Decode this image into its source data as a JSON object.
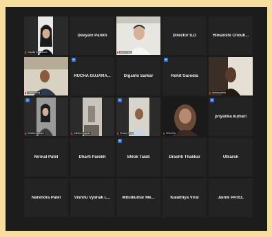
{
  "participants": [
    {
      "name": "Inayatla Chakrabarti",
      "kind": "video"
    },
    {
      "name": "Devyani Parikh",
      "kind": "name"
    },
    {
      "name": "Darsh Patel",
      "kind": "video",
      "active": true
    },
    {
      "name": "Director ILG",
      "kind": "name"
    },
    {
      "name": "Himanshi Chouh...",
      "kind": "name"
    },
    {
      "name": "Tushar Tyagi",
      "kind": "video"
    },
    {
      "name": "RUCHA GUJARA...",
      "kind": "name",
      "badge": "H"
    },
    {
      "name": "Diganto Sarkar",
      "kind": "name"
    },
    {
      "name": "Rohit Garodia",
      "kind": "name",
      "badge": "H"
    },
    {
      "name": "aishwaryatalla",
      "kind": "video"
    },
    {
      "name": "Drishika Kulkarni",
      "kind": "video",
      "badge": "H"
    },
    {
      "name": "prithikurv...ajpura",
      "kind": "video"
    },
    {
      "name": "Himang Tyagi",
      "kind": "video",
      "badge": "H"
    },
    {
      "name": "Hritha Ra...",
      "kind": "video"
    },
    {
      "name": "priyanka kumari",
      "kind": "name",
      "badge": "H"
    },
    {
      "name": "Nirmal Patel",
      "kind": "name"
    },
    {
      "name": "Dharti Parekh",
      "kind": "name"
    },
    {
      "name": "Shlok Talati",
      "kind": "name",
      "badge": "H"
    },
    {
      "name": "Drashti Thakkar",
      "kind": "name"
    },
    {
      "name": "Utkarsh",
      "kind": "name"
    },
    {
      "name": "Narendra Patel",
      "kind": "name"
    },
    {
      "name": "Vishnu Vyshak L...",
      "kind": "name"
    },
    {
      "name": "Mitulkumar Me...",
      "kind": "name"
    },
    {
      "name": "Kalathiya Viral",
      "kind": "name"
    },
    {
      "name": "Jainik PATEL",
      "kind": "name"
    }
  ],
  "badge_label": "H",
  "colors": {
    "background": "#f6df9e",
    "window": "#1c1c1c",
    "tile": "#232323",
    "active_outline": "#cfe22a",
    "mute": "#e03030",
    "badge": "#2d6fd6"
  }
}
